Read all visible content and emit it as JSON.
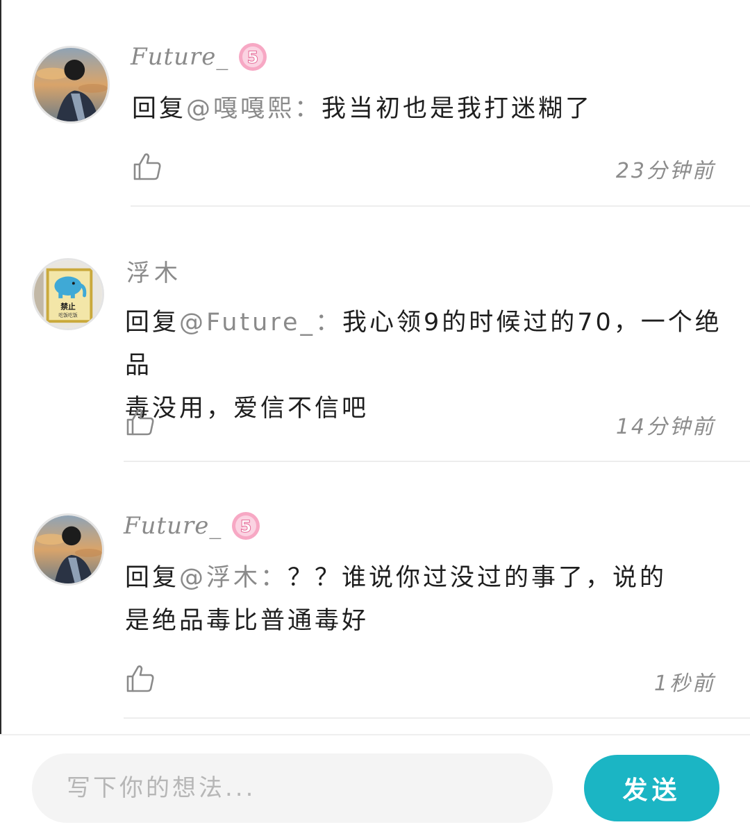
{
  "comments": [
    {
      "username": "Future_",
      "level": "5",
      "reply_prefix": "回复",
      "mention": "@嘎嘎熙：",
      "text": "我当初也是我打迷糊了",
      "timestamp": "23分钟前",
      "avatar_icon": "user-photo-sunset"
    },
    {
      "username": "浮木",
      "reply_prefix": "回复",
      "mention": "@Future_：",
      "text_line1": "我心领9的时候过的70，一个绝品",
      "text_line2": "毒没用，爱信不信吧",
      "timestamp": "14分钟前",
      "avatar_icon": "elephant-sign",
      "avatar_sign_text": "禁止",
      "avatar_sign_subtext": "吃饭吃饭"
    },
    {
      "username": "Future_",
      "level": "5",
      "reply_prefix": "回复",
      "mention": "@浮木：",
      "text_line1": "？？谁说你过没过的事了，说的",
      "text_line2": "是绝品毒比普通毒好",
      "timestamp": "1秒前",
      "avatar_icon": "user-photo-sunset"
    }
  ],
  "composer": {
    "placeholder": "写下你的想法...",
    "send_label": "发送"
  },
  "colors": {
    "accent": "#1bb5c4",
    "badge_pink": "#f48fb1",
    "muted_text": "#8a8a8a",
    "divider": "#ededed"
  },
  "icons": {
    "like": "thumbs-up-icon",
    "level_badge": "level-badge-icon"
  }
}
